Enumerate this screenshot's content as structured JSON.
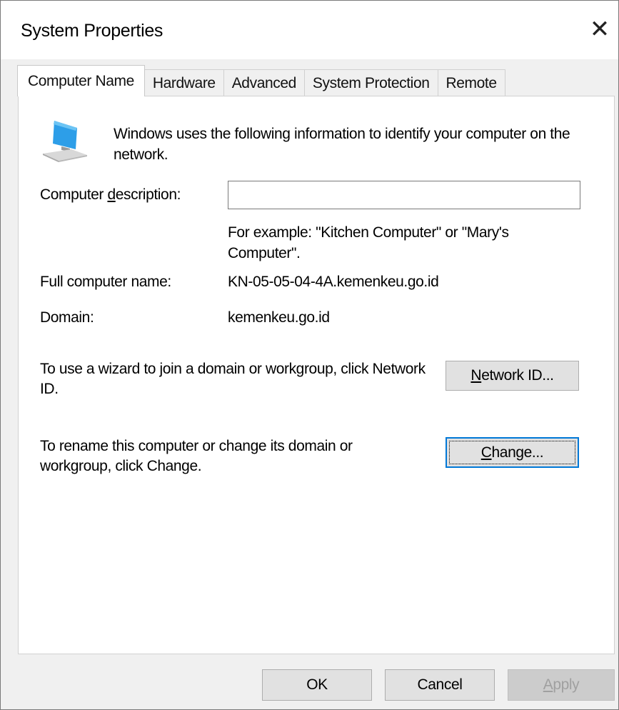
{
  "window": {
    "title": "System Properties",
    "close_glyph": "✕"
  },
  "tabs": [
    {
      "label": "Computer Name",
      "active": true
    },
    {
      "label": "Hardware",
      "active": false
    },
    {
      "label": "Advanced",
      "active": false
    },
    {
      "label": "System Protection",
      "active": false
    },
    {
      "label": "Remote",
      "active": false
    }
  ],
  "content": {
    "icon": "computer-monitor-icon",
    "intro": "Windows uses the following information to identify your computer on the network.",
    "description_label_pre": "Computer ",
    "description_label_key": "d",
    "description_label_post": "escription:",
    "description_value": "",
    "description_placeholder": "",
    "example": "For example: \"Kitchen Computer\" or \"Mary's Computer\".",
    "full_name_label": "Full computer name:",
    "full_name_value": "KN-05-05-04-4A.kemenkeu.go.id",
    "domain_label": "Domain:",
    "domain_value": "kemenkeu.go.id",
    "network_id_text": "To use a wizard to join a domain or workgroup, click Network ID.",
    "network_id_key": "N",
    "network_id_rest": "etwork ID...",
    "change_text": "To rename this computer or change its domain or workgroup, click Change.",
    "change_key": "C",
    "change_rest": "hange..."
  },
  "footer": {
    "ok": "OK",
    "cancel": "Cancel",
    "apply_key": "A",
    "apply_rest": "pply"
  },
  "colors": {
    "accent": "#0078d7",
    "icon_blue": "#2d9ee8"
  }
}
